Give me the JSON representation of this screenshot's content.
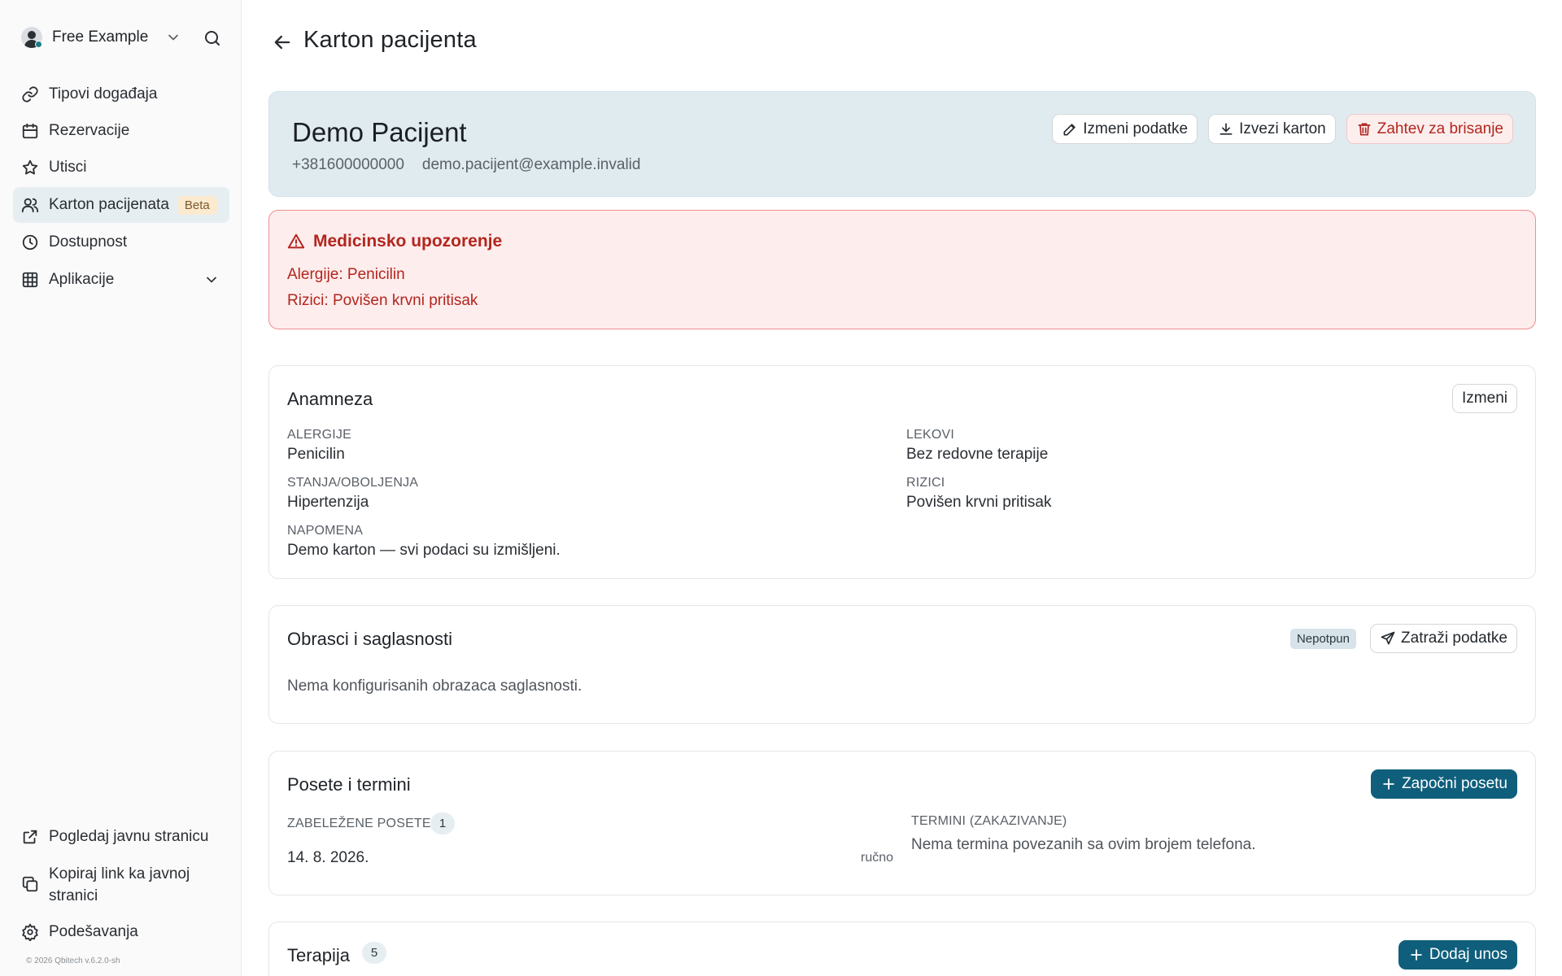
{
  "sidebar": {
    "workspace_name": "Free Example",
    "nav": [
      {
        "label": "Tipovi događaja",
        "icon": "link-icon"
      },
      {
        "label": "Rezervacije",
        "icon": "calendar-icon"
      },
      {
        "label": "Utisci",
        "icon": "star-icon"
      },
      {
        "label": "Karton pacijenata",
        "icon": "users-icon",
        "badge": "Beta",
        "active": true
      },
      {
        "label": "Dostupnost",
        "icon": "clock-icon"
      },
      {
        "label": "Aplikacije",
        "icon": "grid-icon"
      }
    ],
    "bottom": [
      {
        "label": "Pogledaj javnu stranicu",
        "icon": "external-link-icon"
      },
      {
        "label": "Kopiraj link ka javnoj stranici",
        "icon": "copy-icon"
      },
      {
        "label": "Podešavanja",
        "icon": "gear-icon"
      }
    ],
    "copyright": "© 2026 Qbitech v.6.2.0-sh"
  },
  "page": {
    "title": "Karton pacijenta"
  },
  "patient": {
    "name": "Demo Pacijent",
    "phone": "+381600000000",
    "email": "demo.pacijent@example.invalid",
    "actions": {
      "edit": "Izmeni podatke",
      "export": "Izvezi karton",
      "delete": "Zahtev za brisanje"
    }
  },
  "alert": {
    "title": "Medicinsko upozorenje",
    "lines": [
      "Alergije: Penicilin",
      "Rizici: Povišen krvni pritisak"
    ]
  },
  "anamneza": {
    "title": "Anamneza",
    "edit_label": "Izmeni",
    "fields": {
      "alergije": {
        "label": "ALERGIJE",
        "value": "Penicilin"
      },
      "lekovi": {
        "label": "LEKOVI",
        "value": "Bez redovne terapije"
      },
      "stanja": {
        "label": "STANJA/OBOLJENJA",
        "value": "Hipertenzija"
      },
      "rizici": {
        "label": "RIZICI",
        "value": "Povišen krvni pritisak"
      },
      "napomena": {
        "label": "NAPOMENA",
        "value": "Demo karton — svi podaci su izmišljeni."
      }
    }
  },
  "obrasci": {
    "title": "Obrasci i saglasnosti",
    "status": "Nepotpun",
    "request_label": "Zatraži podatke",
    "empty_text": "Nema konfigurisanih obrazaca saglasnosti."
  },
  "posete": {
    "title": "Posete i termini",
    "start_label": "Započni posetu",
    "recorded_label": "ZABELEŽENE POSETE",
    "recorded_count": "1",
    "visits": [
      {
        "date": "14. 8. 2026.",
        "source": "ručno"
      }
    ],
    "termini_label": "TERMINI (ZAKAZIVANJE)",
    "termini_text": "Nema termina povezanih sa ovim brojem telefona."
  },
  "terapija": {
    "title": "Terapija",
    "count": "5",
    "add_label": "Dodaj unos"
  },
  "colors": {
    "accent": "#0f5f7c",
    "danger": "#b3261e",
    "hero_bg": "#e0ebf0",
    "alert_bg": "#fdeded"
  }
}
